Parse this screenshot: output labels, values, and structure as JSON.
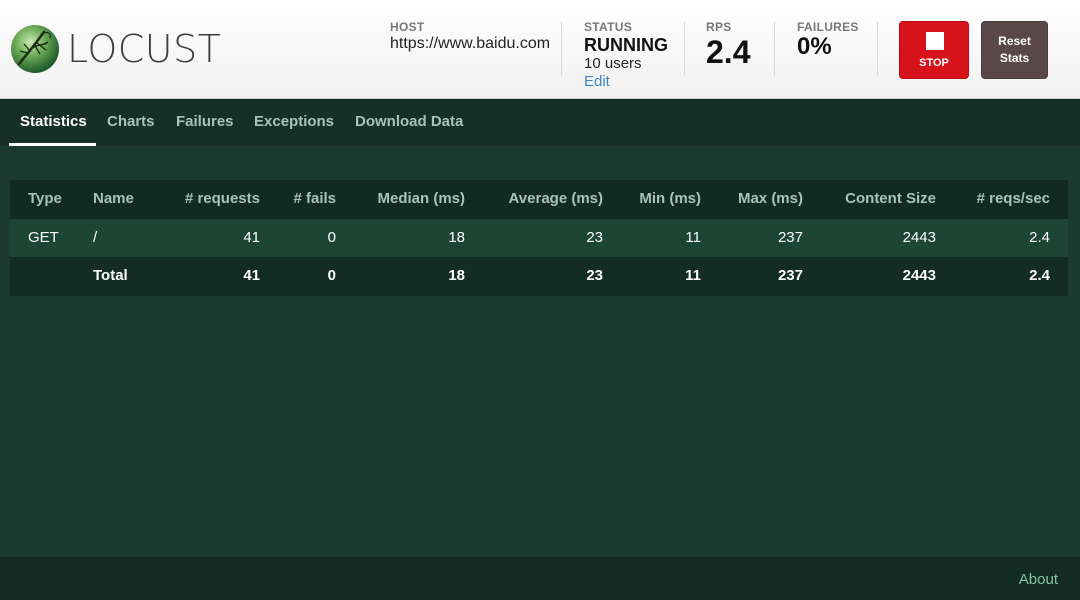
{
  "header": {
    "logo_text": "LOCUST",
    "host": {
      "label": "HOST",
      "value": "https://www.baidu.com"
    },
    "status": {
      "label": "STATUS",
      "value": "RUNNING",
      "users": "10 users",
      "edit": "Edit"
    },
    "rps": {
      "label": "RPS",
      "value": "2.4"
    },
    "failures": {
      "label": "FAILURES",
      "value": "0%"
    },
    "stop_label": "STOP",
    "reset_label": "Reset Stats"
  },
  "tabs": [
    {
      "label": "Statistics",
      "active": true
    },
    {
      "label": "Charts",
      "active": false
    },
    {
      "label": "Failures",
      "active": false
    },
    {
      "label": "Exceptions",
      "active": false
    },
    {
      "label": "Download Data",
      "active": false
    }
  ],
  "table": {
    "headers": [
      "Type",
      "Name",
      "# requests",
      "# fails",
      "Median (ms)",
      "Average (ms)",
      "Min (ms)",
      "Max (ms)",
      "Content Size",
      "# reqs/sec"
    ],
    "rows": [
      [
        "GET",
        "/",
        "41",
        "0",
        "18",
        "23",
        "11",
        "237",
        "2443",
        "2.4"
      ]
    ],
    "total": [
      "",
      "Total",
      "41",
      "0",
      "18",
      "23",
      "11",
      "237",
      "2443",
      "2.4"
    ]
  },
  "footer": {
    "about": "About"
  },
  "colors": {
    "bg": "#1b3a30",
    "tab_bar": "#173027",
    "row_highlight": "#1d4536",
    "stop": "#d8121a",
    "reset": "#5a4747",
    "link": "#3c86c7",
    "about": "#7fc7a4"
  },
  "icons": {
    "logo": "locust-logo-icon",
    "stop": "stop-square-icon"
  }
}
